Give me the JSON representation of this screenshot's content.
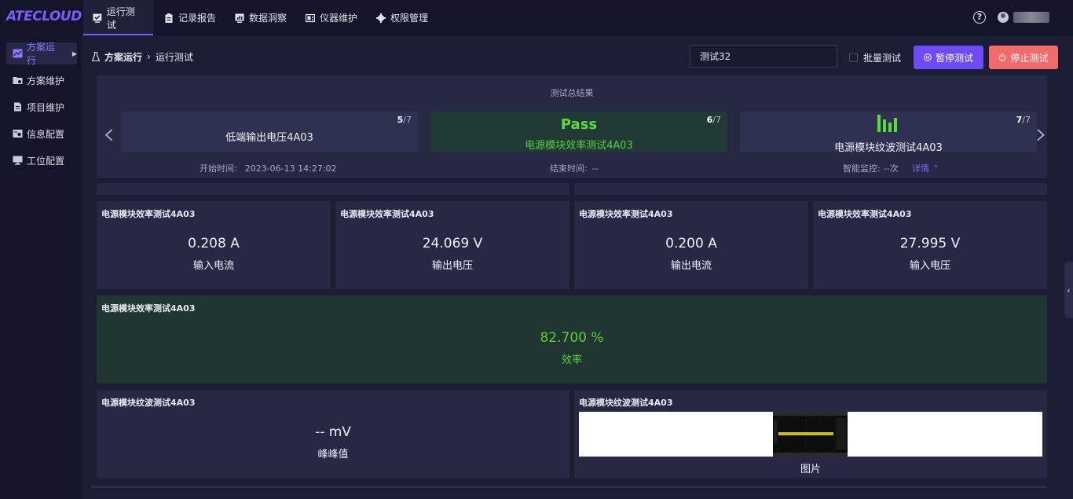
{
  "app": {
    "logo": "ATECLOUD"
  },
  "nav": [
    {
      "label": "运行测试",
      "icon": "monitor-check-icon",
      "active": true
    },
    {
      "label": "记录报告",
      "icon": "clipboard-icon",
      "active": false
    },
    {
      "label": "数据洞察",
      "icon": "chart-monitor-icon",
      "active": false
    },
    {
      "label": "仪器维护",
      "icon": "instrument-icon",
      "active": false
    },
    {
      "label": "权限管理",
      "icon": "gear-icon",
      "active": false
    }
  ],
  "sidebar": [
    {
      "label": "方案运行",
      "icon": "chart-icon",
      "active": true
    },
    {
      "label": "方案维护",
      "icon": "folder-settings-icon",
      "active": false
    },
    {
      "label": "项目维护",
      "icon": "document-icon",
      "active": false
    },
    {
      "label": "信息配置",
      "icon": "info-config-icon",
      "active": false
    },
    {
      "label": "工位配置",
      "icon": "workstation-icon",
      "active": false
    }
  ],
  "breadcrumb": {
    "root": "方案运行",
    "sep": "›",
    "current": "运行测试"
  },
  "toolbar": {
    "plan_name": "测试32",
    "batch_label": "批量测试",
    "pause_label": "暂停测试",
    "stop_label": "停止测试"
  },
  "summary": {
    "title": "测试总结果",
    "cards": [
      {
        "name": "低端输出电压4A03",
        "index": "5",
        "total": "/7",
        "status": ""
      },
      {
        "name": "电源模块效率测试4A03",
        "index": "6",
        "total": "/7",
        "status": "Pass"
      },
      {
        "name": "电源模块纹波测试4A03",
        "index": "7",
        "total": "/7",
        "status": ""
      }
    ],
    "start_label": "开始时间:",
    "start_value": "2023-06-13 14:27:02",
    "end_label": "结束时间:",
    "end_value": "--",
    "monitor_label": "智能监控:",
    "monitor_value": "--次",
    "detail_label": "详情"
  },
  "panels": [
    {
      "title": "电源模块效率测试4A03",
      "value": "0.208  A",
      "label": "输入电流"
    },
    {
      "title": "电源模块效率测试4A03",
      "value": "24.069  V",
      "label": "输出电压"
    },
    {
      "title": "电源模块效率测试4A03",
      "value": "0.200  A",
      "label": "输出电流"
    },
    {
      "title": "电源模块效率测试4A03",
      "value": "27.995  V",
      "label": "输入电压"
    },
    {
      "title": "电源模块效率测试4A03",
      "value": "82.700  %",
      "label": "效率"
    },
    {
      "title": "电源模块纹波测试4A03",
      "value": "--  mV",
      "label": "峰峰值"
    },
    {
      "title": "电源模块纹波测试4A03",
      "value": "",
      "label": "图片"
    }
  ],
  "colors": {
    "accent": "#6d4cf7",
    "pass": "#5bdc3c",
    "stop": "#f26b6b",
    "background": "#1b1d34"
  }
}
